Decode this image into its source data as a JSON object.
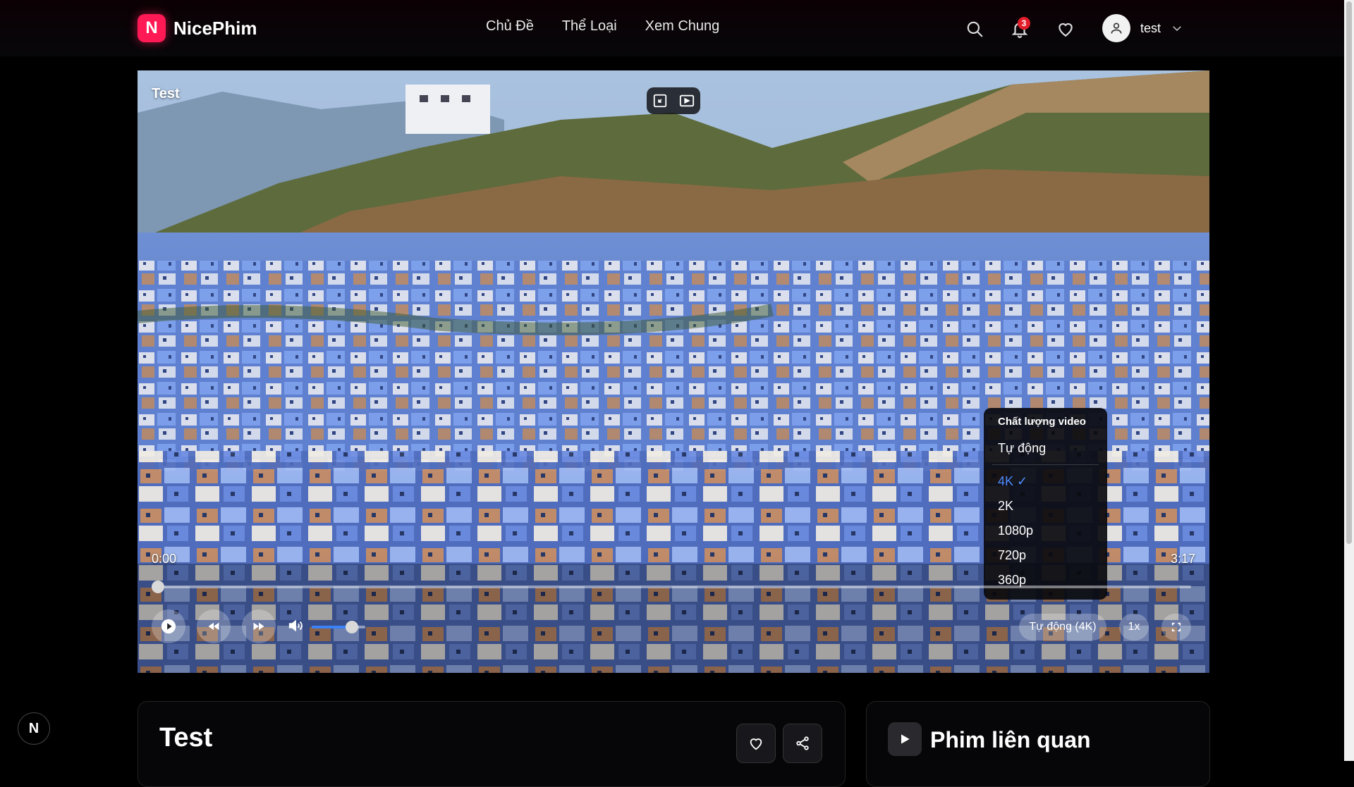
{
  "app": {
    "logo_letter": "N",
    "name": "NicePhim",
    "accent": "#ff1a55"
  },
  "nav": {
    "items": [
      "Chủ Đề",
      "Thể Loại",
      "Xem Chung"
    ]
  },
  "header": {
    "notification_count": "3",
    "username": "test"
  },
  "player": {
    "title": "Test",
    "current_time": "0:00",
    "duration": "3:17",
    "progress_fraction": 0,
    "volume_fraction": 0.75,
    "quality_button": "Tự động (4K)",
    "speed_button": "1x",
    "quality_menu": {
      "title": "Chất lượng video",
      "auto": "Tự động",
      "options": [
        "4K ✓",
        "2K",
        "1080p",
        "720p",
        "360p"
      ],
      "selected": "4K"
    }
  },
  "details": {
    "title": "Test"
  },
  "related": {
    "title": "Phim liên quan"
  },
  "dev_badge": "N"
}
